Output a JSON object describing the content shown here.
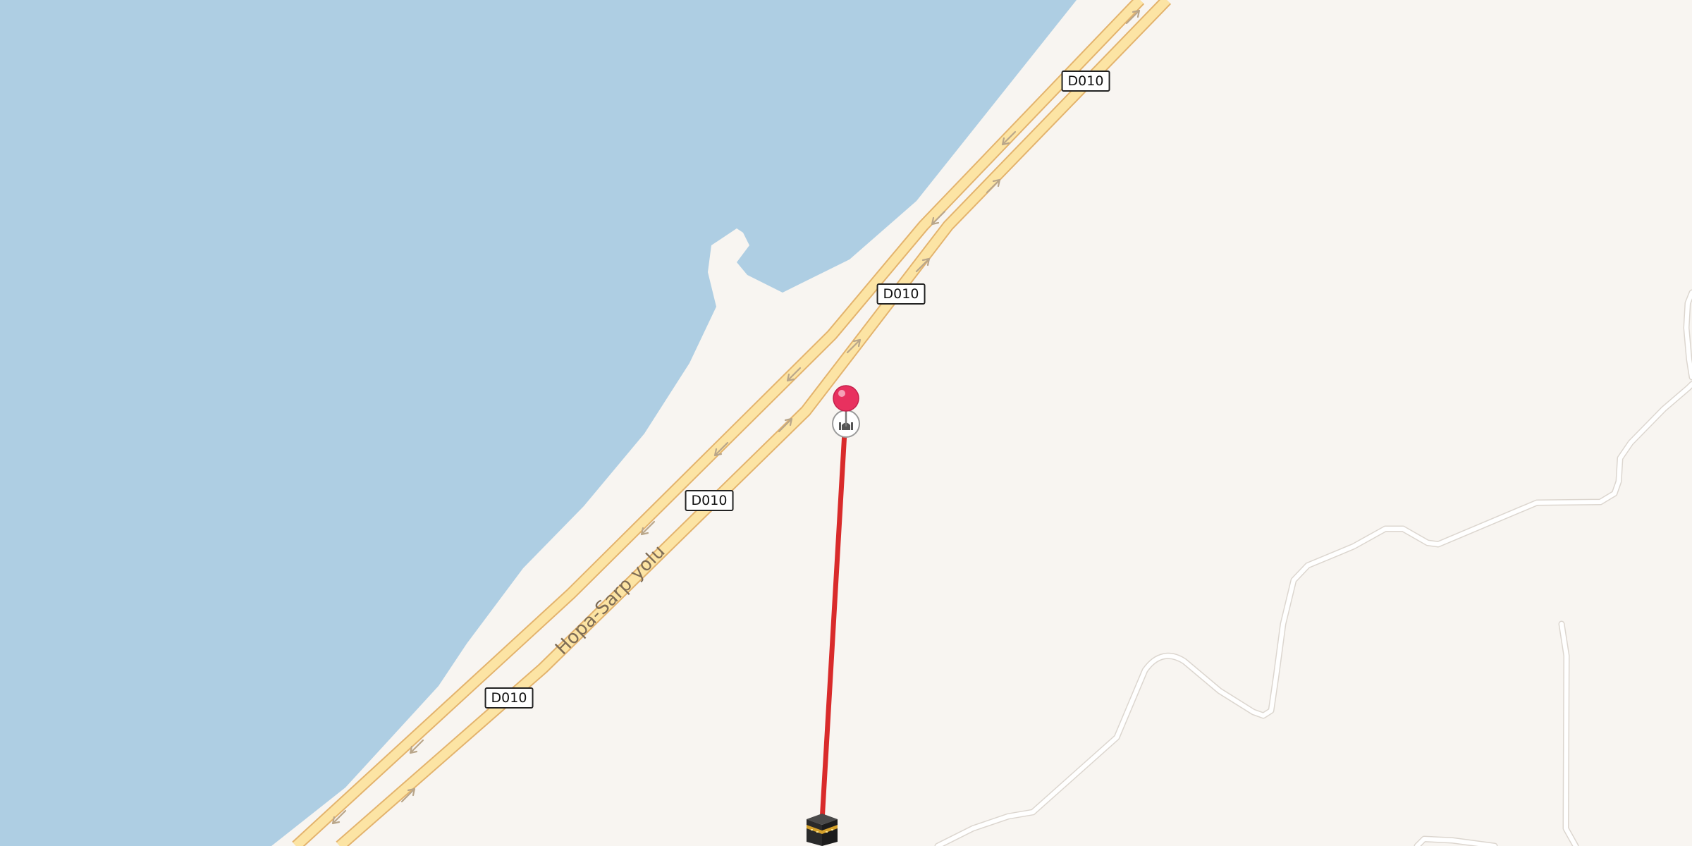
{
  "map": {
    "colors": {
      "water": "#aecee3",
      "land": "#f8f5f1",
      "road_fill": "#fce4a4",
      "road_casing": "#e3b36d",
      "track": "#ffffff",
      "qibla_line": "#d92b2b",
      "pin": "#e8315f"
    },
    "road_shields": [
      {
        "label": "D010"
      },
      {
        "label": "D010"
      },
      {
        "label": "D010"
      },
      {
        "label": "D010"
      }
    ],
    "road_name": "Hopa-Sarp yolu",
    "markers": {
      "location_pin": "map-pin-icon",
      "mosque": "mosque-icon",
      "kaaba": "kaaba-icon"
    }
  }
}
